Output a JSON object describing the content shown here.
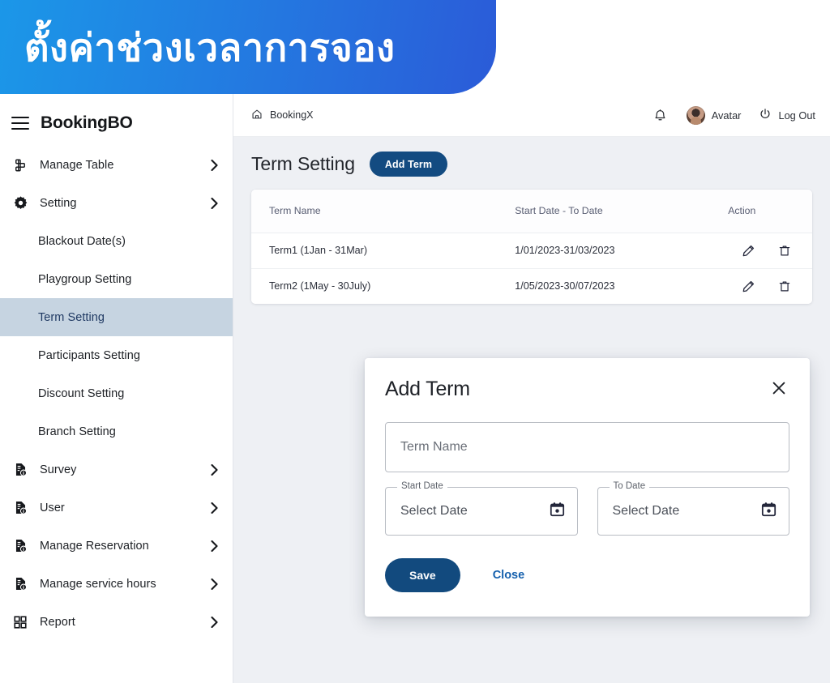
{
  "banner": {
    "text": "ตั้งค่าช่วงเวลาการจอง",
    "gradient_from": "#1b97e8",
    "gradient_to": "#2b5bd8"
  },
  "sidebar": {
    "brand": "BookingBO",
    "menu_icon": "hamburger-icon",
    "items": [
      {
        "label": "Manage Table",
        "icon": "table-grid-icon",
        "type": "parent",
        "chevron": true
      },
      {
        "label": "Setting",
        "icon": "gear-icon",
        "type": "parent",
        "chevron": true,
        "expanded": true
      },
      {
        "label": "Blackout Date(s)",
        "type": "child",
        "active": false
      },
      {
        "label": "Playgroup Setting",
        "type": "child",
        "active": false
      },
      {
        "label": "Term Setting",
        "type": "child",
        "active": true
      },
      {
        "label": "Participants Setting",
        "type": "child",
        "active": false
      },
      {
        "label": "Discount Setting",
        "type": "child",
        "active": false
      },
      {
        "label": "Branch Setting",
        "type": "child",
        "active": false
      },
      {
        "label": "Survey",
        "icon": "document-info-icon",
        "type": "parent",
        "chevron": true
      },
      {
        "label": "User",
        "icon": "document-info-icon",
        "type": "parent",
        "chevron": true
      },
      {
        "label": "Manage Reservation",
        "icon": "document-info-icon",
        "type": "parent",
        "chevron": true
      },
      {
        "label": "Manage service hours",
        "icon": "document-info-icon",
        "type": "parent",
        "chevron": true
      },
      {
        "label": "Report",
        "icon": "grid-squares-icon",
        "type": "parent",
        "chevron": true
      }
    ],
    "active_bg": "#c6d4e1",
    "active_text": "#203a63"
  },
  "topbar": {
    "breadcrumb": "BookingX",
    "home_icon": "home-icon",
    "notification_icon": "bell-icon",
    "avatar_label": "Avatar",
    "logout_label": "Log Out",
    "logout_icon": "power-icon"
  },
  "page": {
    "title": "Term Setting",
    "add_button": "Add Term",
    "accent_color": "#134b81"
  },
  "table": {
    "columns": [
      "Term Name",
      "Start Date - To Date",
      "Action"
    ],
    "rows": [
      {
        "term_name": "Term1 (1Jan - 31Mar)",
        "date_range": "1/01/2023-31/03/2023",
        "edit_icon": "pencil-icon",
        "delete_icon": "trash-icon"
      },
      {
        "term_name": "Term2 (1May - 30July)",
        "date_range": "1/05/2023-30/07/2023",
        "edit_icon": "pencil-icon",
        "delete_icon": "trash-icon"
      }
    ]
  },
  "modal": {
    "title": "Add Term",
    "close_icon": "close-x-icon",
    "term_name_placeholder": "Term Name",
    "term_name_value": "",
    "start_date": {
      "legend": "Start Date",
      "value": "Select Date",
      "icon": "calendar-icon"
    },
    "to_date": {
      "legend": "To Date",
      "value": "Select Date",
      "icon": "calendar-icon"
    },
    "save_label": "Save",
    "close_label": "Close",
    "save_color": "#124a7e",
    "close_color": "#1560ad"
  }
}
